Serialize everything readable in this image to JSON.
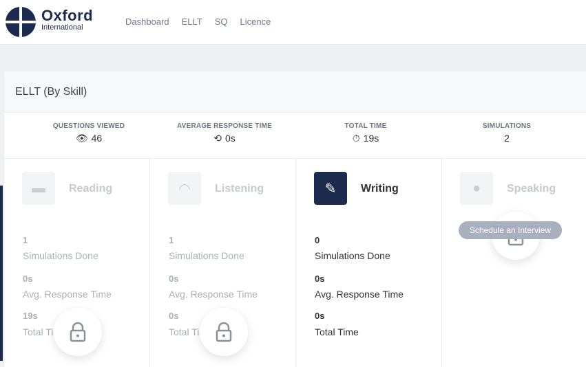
{
  "header": {
    "brand": "Oxford",
    "brand_sub": "International",
    "nav": [
      "Dashboard",
      "ELLT",
      "SQ",
      "Licence"
    ]
  },
  "card": {
    "title": "ELLT (By Skill)"
  },
  "stats": [
    {
      "label": "QUESTIONS VIEWED",
      "icon": "eye-icon",
      "glyph": "👁",
      "value": "46"
    },
    {
      "label": "AVERAGE RESPONSE TIME",
      "icon": "response-time-icon",
      "glyph": "⟲",
      "value": "0s"
    },
    {
      "label": "TOTAL TIME",
      "icon": "stopwatch-icon",
      "glyph": "⏱",
      "value": "19s"
    },
    {
      "label": "SIMULATIONS",
      "icon": "",
      "glyph": "",
      "value": "2"
    }
  ],
  "skills": [
    {
      "name": "Reading",
      "icon": "book-icon",
      "glyph": "▬",
      "sims": "1",
      "sims_label": "Simulations Done",
      "resp": "0s",
      "resp_label": "Avg. Response Time",
      "total": "19s",
      "total_label": "Total Time",
      "locked": true
    },
    {
      "name": "Listening",
      "icon": "headphones-icon",
      "glyph": "◠",
      "sims": "1",
      "sims_label": "Simulations Done",
      "resp": "0s",
      "resp_label": "Avg. Response Time",
      "total": "0s",
      "total_label": "Total Time",
      "locked": true
    },
    {
      "name": "Writing",
      "icon": "pencil-icon",
      "glyph": "✎",
      "sims": "0",
      "sims_label": "Simulations Done",
      "resp": "0s",
      "resp_label": "Avg. Response Time",
      "total": "0s",
      "total_label": "Total Time",
      "locked": false
    },
    {
      "name": "Speaking",
      "icon": "microphone-icon",
      "glyph": "●",
      "sims": "",
      "sims_label": "",
      "resp": "",
      "resp_label": "",
      "total": "",
      "total_label": "",
      "locked": true
    }
  ],
  "schedule_button": "Schedule an Interview",
  "colors": {
    "brand": "#1d2b4f",
    "muted": "#aab0b6",
    "button": "#a9afbd"
  }
}
